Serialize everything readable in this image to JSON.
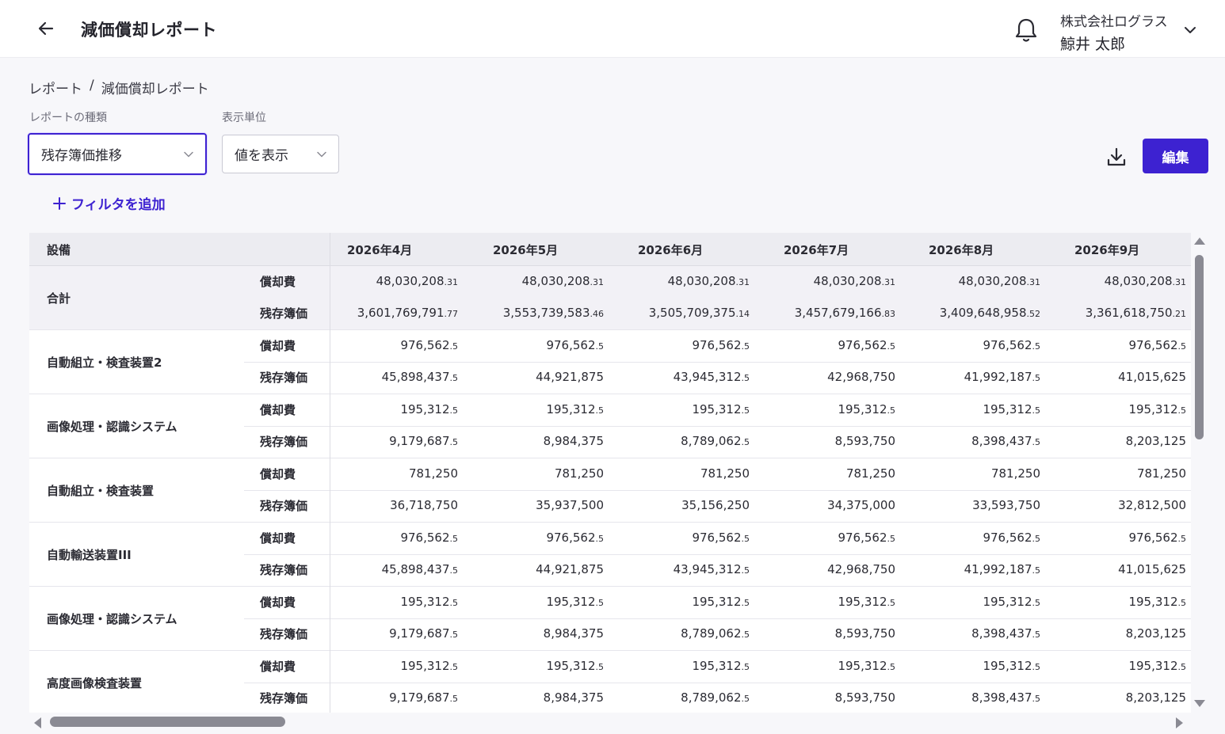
{
  "header": {
    "title": "減価償却レポート",
    "org_name": "株式会社ログラス",
    "user_name": "鯨井 太郎"
  },
  "breadcrumb": {
    "root": "レポート",
    "separator": "/",
    "current": "減価償却レポート"
  },
  "controls": {
    "report_type_label": "レポートの種類",
    "report_type_value": "残存簿価推移",
    "unit_label": "表示単位",
    "unit_value": "値を表示",
    "edit_label": "編集",
    "add_filter_label": "フィルタを追加"
  },
  "table": {
    "first_header": "設備",
    "months": [
      "2026年4月",
      "2026年5月",
      "2026年6月",
      "2026年7月",
      "2026年8月",
      "2026年9月"
    ],
    "groups": [
      {
        "name": "合計",
        "rows": [
          {
            "metric": "償却費",
            "values": [
              [
                "48,030,208",
                ".31"
              ],
              [
                "48,030,208",
                ".31"
              ],
              [
                "48,030,208",
                ".31"
              ],
              [
                "48,030,208",
                ".31"
              ],
              [
                "48,030,208",
                ".31"
              ],
              [
                "48,030,208",
                ".31"
              ]
            ]
          },
          {
            "metric": "残存簿価",
            "values": [
              [
                "3,601,769,791",
                ".77"
              ],
              [
                "3,553,739,583",
                ".46"
              ],
              [
                "3,505,709,375",
                ".14"
              ],
              [
                "3,457,679,166",
                ".83"
              ],
              [
                "3,409,648,958",
                ".52"
              ],
              [
                "3,361,618,750",
                ".21"
              ]
            ]
          }
        ]
      },
      {
        "name": "自動組立・検査装置2",
        "rows": [
          {
            "metric": "償却費",
            "values": [
              [
                "976,562",
                ".5"
              ],
              [
                "976,562",
                ".5"
              ],
              [
                "976,562",
                ".5"
              ],
              [
                "976,562",
                ".5"
              ],
              [
                "976,562",
                ".5"
              ],
              [
                "976,562",
                ".5"
              ]
            ]
          },
          {
            "metric": "残存簿価",
            "values": [
              [
                "45,898,437",
                ".5"
              ],
              [
                "44,921,875",
                ""
              ],
              [
                "43,945,312",
                ".5"
              ],
              [
                "42,968,750",
                ""
              ],
              [
                "41,992,187",
                ".5"
              ],
              [
                "41,015,625",
                ""
              ]
            ]
          }
        ]
      },
      {
        "name": "画像処理・認識システム",
        "rows": [
          {
            "metric": "償却費",
            "values": [
              [
                "195,312",
                ".5"
              ],
              [
                "195,312",
                ".5"
              ],
              [
                "195,312",
                ".5"
              ],
              [
                "195,312",
                ".5"
              ],
              [
                "195,312",
                ".5"
              ],
              [
                "195,312",
                ".5"
              ]
            ]
          },
          {
            "metric": "残存簿価",
            "values": [
              [
                "9,179,687",
                ".5"
              ],
              [
                "8,984,375",
                ""
              ],
              [
                "8,789,062",
                ".5"
              ],
              [
                "8,593,750",
                ""
              ],
              [
                "8,398,437",
                ".5"
              ],
              [
                "8,203,125",
                ""
              ]
            ]
          }
        ]
      },
      {
        "name": "自動組立・検査装置",
        "rows": [
          {
            "metric": "償却費",
            "values": [
              [
                "781,250",
                ""
              ],
              [
                "781,250",
                ""
              ],
              [
                "781,250",
                ""
              ],
              [
                "781,250",
                ""
              ],
              [
                "781,250",
                ""
              ],
              [
                "781,250",
                ""
              ]
            ]
          },
          {
            "metric": "残存簿価",
            "values": [
              [
                "36,718,750",
                ""
              ],
              [
                "35,937,500",
                ""
              ],
              [
                "35,156,250",
                ""
              ],
              [
                "34,375,000",
                ""
              ],
              [
                "33,593,750",
                ""
              ],
              [
                "32,812,500",
                ""
              ]
            ]
          }
        ]
      },
      {
        "name": "自動輸送装置III",
        "rows": [
          {
            "metric": "償却費",
            "values": [
              [
                "976,562",
                ".5"
              ],
              [
                "976,562",
                ".5"
              ],
              [
                "976,562",
                ".5"
              ],
              [
                "976,562",
                ".5"
              ],
              [
                "976,562",
                ".5"
              ],
              [
                "976,562",
                ".5"
              ]
            ]
          },
          {
            "metric": "残存簿価",
            "values": [
              [
                "45,898,437",
                ".5"
              ],
              [
                "44,921,875",
                ""
              ],
              [
                "43,945,312",
                ".5"
              ],
              [
                "42,968,750",
                ""
              ],
              [
                "41,992,187",
                ".5"
              ],
              [
                "41,015,625",
                ""
              ]
            ]
          }
        ]
      },
      {
        "name": "画像処理・認識システム",
        "rows": [
          {
            "metric": "償却費",
            "values": [
              [
                "195,312",
                ".5"
              ],
              [
                "195,312",
                ".5"
              ],
              [
                "195,312",
                ".5"
              ],
              [
                "195,312",
                ".5"
              ],
              [
                "195,312",
                ".5"
              ],
              [
                "195,312",
                ".5"
              ]
            ]
          },
          {
            "metric": "残存簿価",
            "values": [
              [
                "9,179,687",
                ".5"
              ],
              [
                "8,984,375",
                ""
              ],
              [
                "8,789,062",
                ".5"
              ],
              [
                "8,593,750",
                ""
              ],
              [
                "8,398,437",
                ".5"
              ],
              [
                "8,203,125",
                ""
              ]
            ]
          }
        ]
      },
      {
        "name": "高度画像検査装置",
        "rows": [
          {
            "metric": "償却費",
            "values": [
              [
                "195,312",
                ".5"
              ],
              [
                "195,312",
                ".5"
              ],
              [
                "195,312",
                ".5"
              ],
              [
                "195,312",
                ".5"
              ],
              [
                "195,312",
                ".5"
              ],
              [
                "195,312",
                ".5"
              ]
            ]
          },
          {
            "metric": "残存簿価",
            "values": [
              [
                "9,179,687",
                ".5"
              ],
              [
                "8,984,375",
                ""
              ],
              [
                "8,789,062",
                ".5"
              ],
              [
                "8,593,750",
                ""
              ],
              [
                "8,398,437",
                ".5"
              ],
              [
                "8,203,125",
                ""
              ]
            ]
          }
        ]
      }
    ]
  },
  "icons": {
    "back": "arrow-left-icon",
    "notifications": "bell-icon",
    "account_menu": "chevron-down-icon",
    "select": "chevron-down-icon",
    "download": "download-icon",
    "add": "plus-icon"
  },
  "colors": {
    "accent": "#3d22d1",
    "header_bg": "#ececf1",
    "total_row_bg": "#f2f1f6",
    "page_bg": "#f7f7fa"
  }
}
